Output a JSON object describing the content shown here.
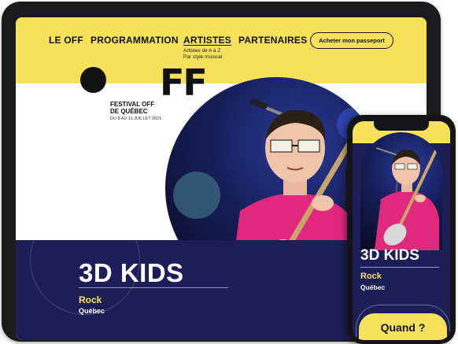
{
  "tablet": {
    "nav": {
      "items": [
        {
          "label": "LE OFF"
        },
        {
          "label": "PROGRAMMATION"
        },
        {
          "label": "ARTISTES"
        },
        {
          "label": "PARTENAIRES"
        }
      ],
      "artistes_sub": [
        "Artistes de A à Z",
        "Par style musical"
      ],
      "pass_button": "Acheter mon passeport"
    },
    "logo_text": "FF",
    "festival": {
      "name_line1": "FESTIVAL OFF",
      "name_line2": "DE QUÉBEC",
      "dates": "DU 8 AU 11 JUILLET 2021"
    },
    "artist": {
      "name": "3D KIDS",
      "genre": "Rock",
      "city": "Québec"
    }
  },
  "phone": {
    "artist": {
      "name": "3D KIDS",
      "genre": "Rock",
      "city": "Québec"
    },
    "cta": "Quand ?"
  },
  "colors": {
    "yellow": "#f7e15a",
    "navy": "#1c1e57",
    "magenta": "#e0287e"
  },
  "icons": [
    "logo-circle-icon"
  ]
}
